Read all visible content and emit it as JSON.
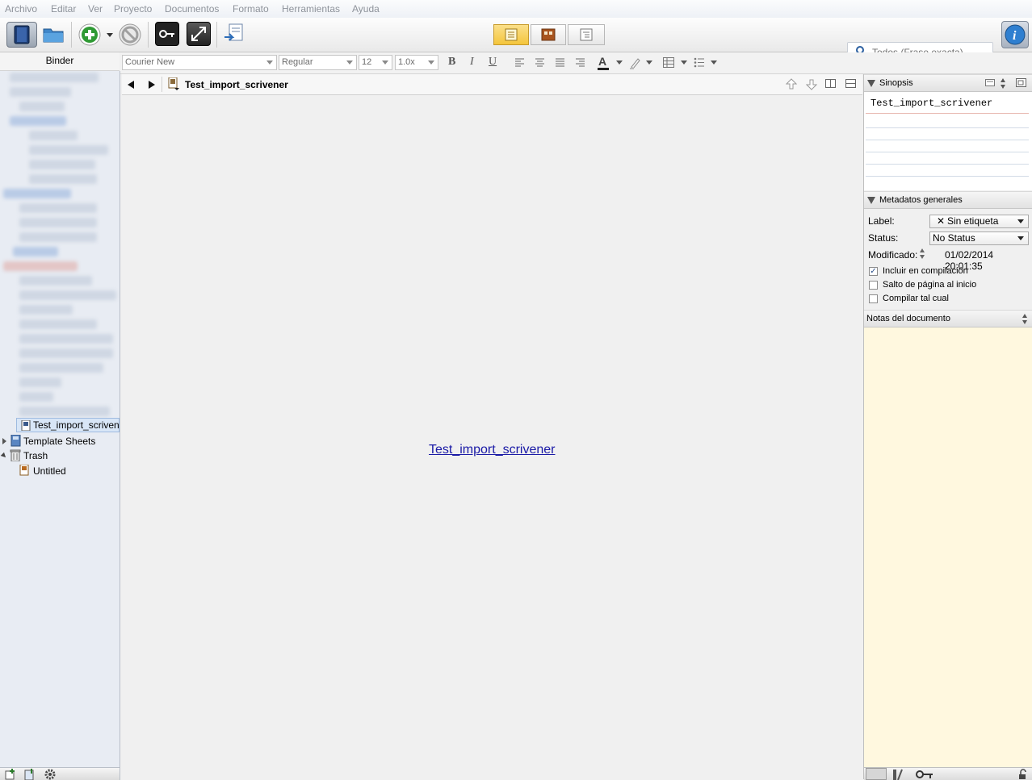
{
  "menu": [
    "Archivo",
    "Editar",
    "Ver",
    "Proyecto",
    "Documentos",
    "Formato",
    "Herramientas",
    "Ayuda"
  ],
  "toolbar": {
    "icons": [
      "binder-toggle-icon",
      "collections-icon",
      "add-icon",
      "delete-icon",
      "keywords-icon",
      "composition-mode-icon",
      "compile-icon",
      "view-document-icon",
      "view-corkboard-icon",
      "view-outline-icon",
      "inspector-icon"
    ],
    "search_placeholder": "Todos (Frase exacta)"
  },
  "binder": {
    "title": "Binder",
    "items": [
      {
        "label": "Test_import_scrivener",
        "selected": true
      },
      {
        "label": "Template Sheets",
        "expandable": true
      },
      {
        "label": "Trash",
        "expanded": true
      },
      {
        "label": "Untitled"
      }
    ]
  },
  "format": {
    "font": "Courier New",
    "style": "Regular",
    "size": "12",
    "spacing": "1.0x",
    "bold": "B",
    "italic": "I",
    "underline": "U",
    "text_color_glyph": "A"
  },
  "editor": {
    "title": "Test_import_scrivener",
    "link_text": "Test_import_scrivener"
  },
  "inspector": {
    "synopsis_title": "Sinopsis",
    "synopsis_text": "Test_import_scrivener",
    "metadata_title": "Metadatos generales",
    "label_caption": "Label:",
    "label_value": "Sin etiqueta",
    "status_caption": "Status:",
    "status_value": "No Status",
    "modified_caption": "Modificado:",
    "modified_value": "01/02/2014 20:01:35",
    "checkboxes": [
      {
        "label": "Incluir en compilación",
        "checked": true
      },
      {
        "label": "Salto de página al inicio",
        "checked": false
      },
      {
        "label": "Compilar tal cual",
        "checked": false
      }
    ],
    "notes_title": "Notas del documento"
  },
  "colors": {
    "accent": "#2b6cb8",
    "notes_bg": "#fff8df",
    "active_view": "#f7cf4a",
    "link": "#1a1aa6"
  }
}
